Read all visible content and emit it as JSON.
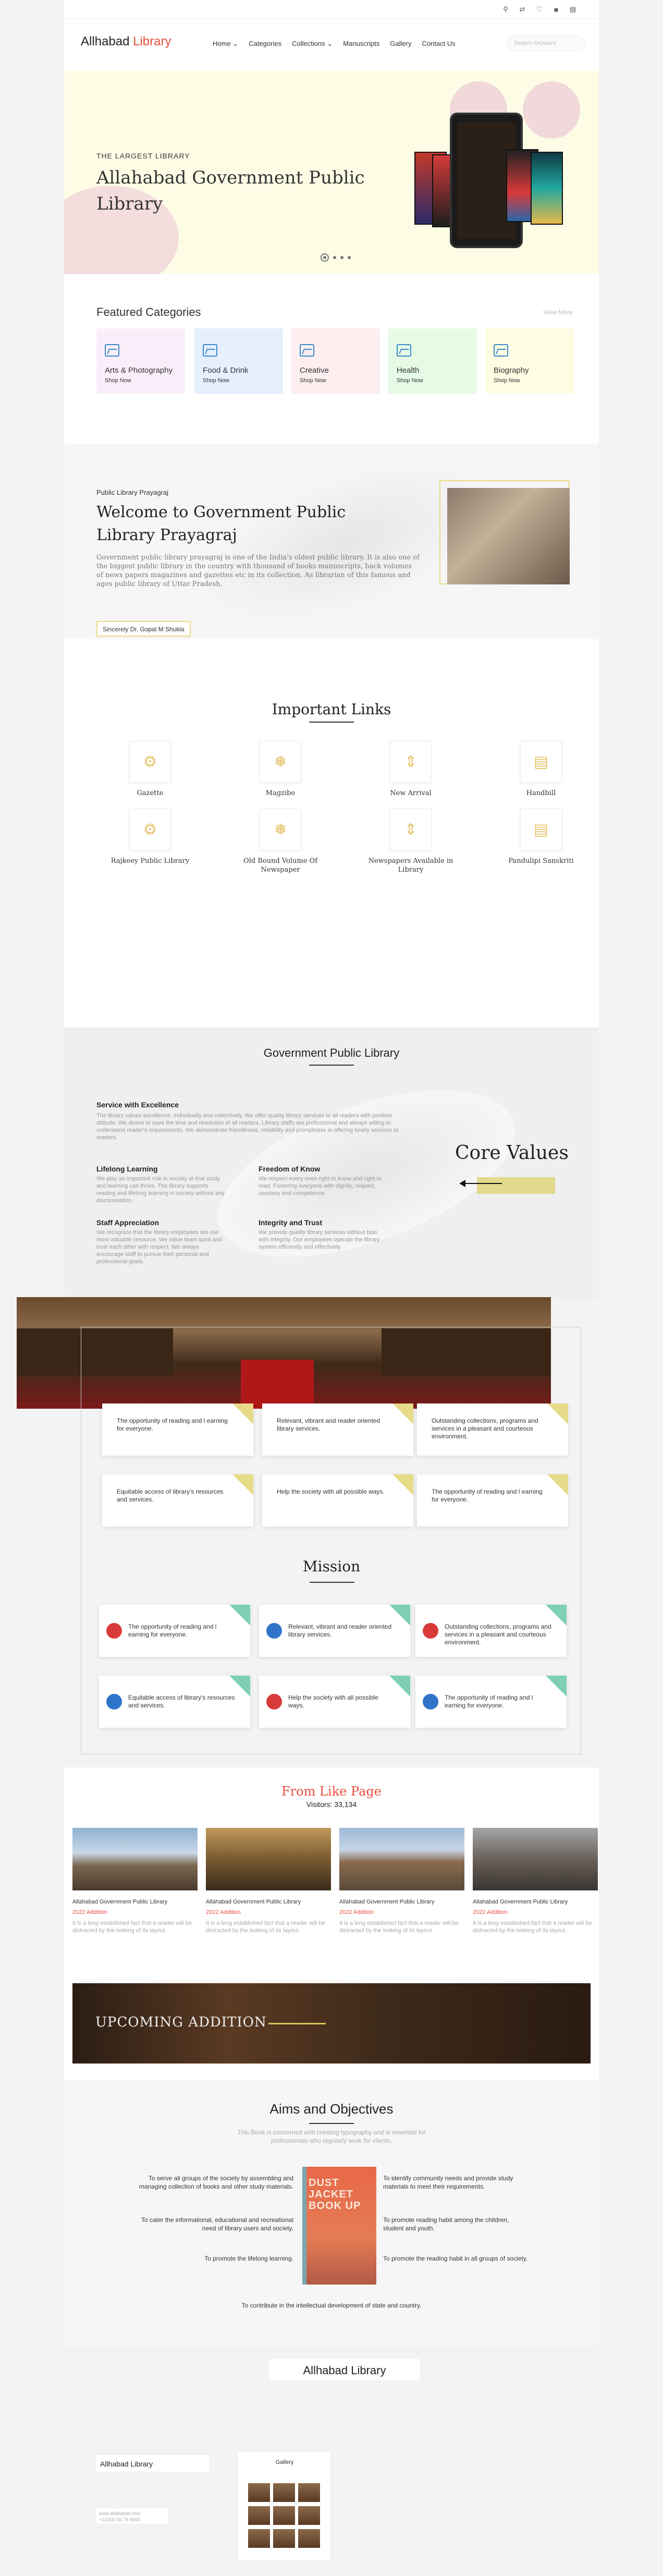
{
  "header": {
    "logo_main": "Allhabad ",
    "logo_accent": "Library",
    "nav": [
      "Home",
      "Categories",
      "Collections",
      "Manuscripts",
      "Gallery",
      "Contact Us"
    ],
    "search_placeholder": "Search Keyword"
  },
  "topbar": {
    "icons": [
      "location-icon",
      "share-icon",
      "heart-icon",
      "user-icon",
      "book-icon"
    ]
  },
  "hero": {
    "eyebrow": "THE LARGEST LIBRARY",
    "title": "Allahabad Government Public Library",
    "slide_count": 4,
    "active_slide": 1
  },
  "featured": {
    "title": "Featured Categories",
    "view_more": "View More",
    "categories": [
      {
        "name": "Arts & Photography",
        "cta": "Shop Now",
        "bg": "#fbeefb"
      },
      {
        "name": "Food & Drink",
        "cta": "Shop Now",
        "bg": "#e6effd"
      },
      {
        "name": "Creative",
        "cta": "Shop Now",
        "bg": "#fdeef0"
      },
      {
        "name": "Health",
        "cta": "Shop Now",
        "bg": "#e6fbe6"
      },
      {
        "name": "Biography",
        "cta": "Shop Now",
        "bg": "#fdfde3"
      }
    ]
  },
  "welcome": {
    "eyebrow": "Public Library Prayagraj",
    "title": "Welcome to Government Public Library Prayagraj",
    "text": "Government public library prayagraj is one of the India's oldest public library. It is also one of the biggest public library in the country with thousand of books manuscripts, back volumes of news papers magazines and gazettes etc in its collection. As librarian of this famous and ages public library of Uttar Pradesh.",
    "signature": "Sincerely Dr. Gopal M Shukla"
  },
  "important": {
    "title": "Important Links",
    "links": [
      {
        "name": "Gazette",
        "icon": "gazette-icon"
      },
      {
        "name": "Magzibe",
        "icon": "magazine-icon"
      },
      {
        "name": "New Arrival",
        "icon": "new-arrival-icon"
      },
      {
        "name": "Handbill",
        "icon": "handbill-icon"
      },
      {
        "name": "Rajkeey Public Library",
        "icon": "library-icon"
      },
      {
        "name": "Old Bound Volume Of Newspaper",
        "icon": "newspaper-icon"
      },
      {
        "name": "Newspapers Available in Library",
        "icon": "newspapers-icon"
      },
      {
        "name": "Pandulipi Sanskriti",
        "icon": "manuscript-icon"
      }
    ]
  },
  "core": {
    "title": "Government Public Library",
    "label": "Core Values",
    "intro_heading": "Service with Excellence",
    "intro_text": "The library values excellence, individually and collectively. We offer quality library services to all readers with positive attitude. We desire to save the time and resolution of all readers. Library staffs are professional and always willing to understand reader's requirements. We demonstrate friendliness, reliability and promptness in offering timely services to readers.",
    "items": [
      {
        "heading": "Lifelong Learning",
        "text": "We play an important role in society at that study and learning can thrive. The library supports reading and lifelong learning in society without any discrimination."
      },
      {
        "heading": "Freedom of Know",
        "text": "We respect every ones right to know and right to read. Fostering everyone with dignity, respect, courtesy and competence."
      },
      {
        "heading": "Staff Appreciation",
        "text": "We recognize that the library employees are our most valuable resource. We value team spirit and trust each other with respect. We always encourage staff to pursue their personal and professional goals."
      },
      {
        "heading": "Integrity and Trust",
        "text": "We provide quality library services without bias with integrity. Our employees operate the library system efficiently and effectively."
      }
    ]
  },
  "values": [
    "The opportunity of reading and l earning for everyone.",
    "Relevant, vibrant and reader oriented library services.",
    "Outstanding collections, programs and services in a pleasant and courteous environment.",
    "Equitable access of library's resources and services.",
    "Help the society with all possible ways.",
    "The opportunity of reading and l earning for everyone."
  ],
  "mission": {
    "title": "Mission",
    "items": [
      {
        "text": "The opportunity of reading and l earning for everyone.",
        "color": "#d83a3a"
      },
      {
        "text": "Relevant, vibrant and reader oriented library services.",
        "color": "#2f74c9"
      },
      {
        "text": "Outstanding collections, programs and services in a pleasant and courteous environment.",
        "color": "#d83a3a"
      },
      {
        "text": "Equitable access of library's resources and services.",
        "color": "#2f74c9"
      },
      {
        "text": "Help the society with all possible ways.",
        "color": "#d83a3a"
      },
      {
        "text": "The opportunity of reading and l earning for everyone.",
        "color": "#2f74c9"
      }
    ]
  },
  "like": {
    "title": "From Like Page",
    "visitors": "Visitors: 33,134",
    "cards": [
      {
        "title": "Allahabad Government Public Library",
        "year": "2022 Addition",
        "desc": "It is a long established fact that a reader will be distracted by the looking of its layout."
      },
      {
        "title": "Allahabad Government Public Library",
        "year": "2022 Addition",
        "desc": "It is a long established fact that a reader will be distracted by the looking of its layout."
      },
      {
        "title": "Allahabad Government Public Library",
        "year": "2022 Addition",
        "desc": "It is a long established fact that a reader will be distracted by the looking of its layout."
      },
      {
        "title": "Allahabad Government Public Library",
        "year": "2022 Addition",
        "desc": "It is a long established fact that a reader will be distracted by the looking of its layout."
      }
    ],
    "upcoming": "UPCOMING ADDITION"
  },
  "aims": {
    "title": "Aims and Objectives",
    "subtitle": "This Book is concerned with creating typography and is essential for professionals who regularly work for clients.",
    "left": [
      "To serve all groups of the society by assembling and managing collection of books and other study materials.",
      "To cater the informational, educational and recreational need of library users and society.",
      "To promote the lifelong learning."
    ],
    "right": [
      "To identify community needs and provide study materials to meet their requirements.",
      "To promote reading habit among the children, student and youth.",
      "To promote the reading habit in all groups of society."
    ],
    "bottom": "To contribute in the intellectual development of state and country.",
    "book_title": "DUST JACKET BOOK UP"
  },
  "footer": {
    "title": "Allhabad Library",
    "brand": "Allhabad Library",
    "email": "www.allahabad.com",
    "phone": "+1(234) 56 78 9000",
    "gallery_label": "Gallery"
  }
}
